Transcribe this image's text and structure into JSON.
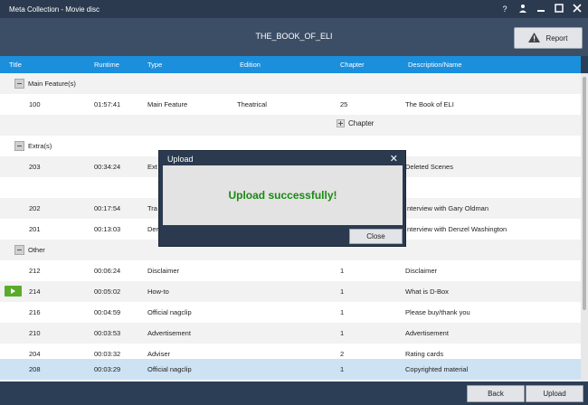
{
  "window": {
    "title": "Meta Collection - Movie disc",
    "controls": [
      "?",
      "user-icon",
      "minimize-icon",
      "maximize-icon",
      "close-icon"
    ]
  },
  "header": {
    "disc_title": "THE_BOOK_OF_ELI",
    "report_label": "Report"
  },
  "columns": [
    "Title",
    "Runtime",
    "Type",
    "Edition",
    "Chapter",
    "Description/Name"
  ],
  "groups": {
    "main": "Main Feature(s)",
    "extras": "Extra(s)",
    "other": "Other"
  },
  "rows": {
    "r100": {
      "title": "100",
      "runtime": "01:57:41",
      "type": "Main Feature",
      "edition": "Theatrical",
      "chapter": "25",
      "desc": "The Book of ELI"
    },
    "add_chapter": "Chapter",
    "r203": {
      "title": "203",
      "runtime": "00:34:24",
      "type": "Ext",
      "desc": "Deleted Scenes"
    },
    "r202": {
      "title": "202",
      "runtime": "00:17:54",
      "type": "Tra",
      "desc": "nterview with Gary Oldman"
    },
    "r201": {
      "title": "201",
      "runtime": "00:13:03",
      "type": "Der",
      "desc": "nterview with Denzel Washington"
    },
    "r212": {
      "title": "212",
      "runtime": "00:06:24",
      "type": "Disclaimer",
      "chapter": "1",
      "desc": "Disclaimer"
    },
    "r214": {
      "title": "214",
      "runtime": "00:05:02",
      "type": "How-to",
      "chapter": "1",
      "desc": "What is D-Box"
    },
    "r216": {
      "title": "216",
      "runtime": "00:04:59",
      "type": "Official nagclip",
      "chapter": "1",
      "desc": "Please buy/thank you"
    },
    "r210": {
      "title": "210",
      "runtime": "00:03:53",
      "type": "Advertisement",
      "chapter": "1",
      "desc": "Advertisement"
    },
    "r204": {
      "title": "204",
      "runtime": "00:03:32",
      "type": "Adviser",
      "chapter": "2",
      "desc": "Rating cards"
    },
    "r208": {
      "title": "208",
      "runtime": "00:03:29",
      "type": "Official nagclip",
      "chapter": "1",
      "desc": "Copyrighted material"
    }
  },
  "footer": {
    "back_label": "Back",
    "upload_label": "Upload"
  },
  "dialog": {
    "title": "Upload",
    "message": "Upload successfully!",
    "close_label": "Close"
  },
  "colors": {
    "accent": "#1b8fdc",
    "success": "#1a8a12",
    "play": "#5aab2a"
  }
}
